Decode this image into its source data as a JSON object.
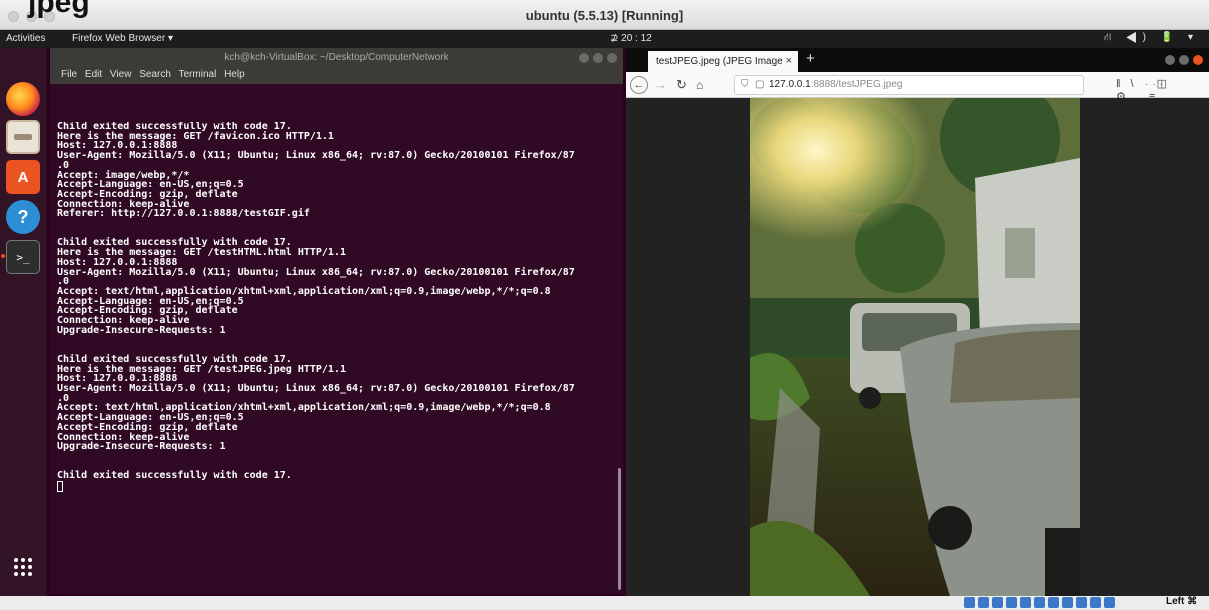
{
  "host_window": {
    "title": "ubuntu (5.5.13) [Running]",
    "cut_heading": "jpeg",
    "host_key": "Left ⌘"
  },
  "topbar": {
    "activities": "Activities",
    "app_menu": "Firefox Web Browser ▾",
    "clock": "⊉ 20 : 12",
    "tray": "⛙ ◀) 🔋 ▾"
  },
  "dock": {
    "items": [
      "firefox-icon",
      "files-icon",
      "software-center-icon",
      "help-icon",
      "terminal-icon"
    ],
    "apps_grid": "show-applications-icon"
  },
  "terminal": {
    "title": "kch@kch-VirtualBox: ~/Desktop/ComputerNetwork",
    "menu": [
      "File",
      "Edit",
      "View",
      "Search",
      "Terminal",
      "Help"
    ],
    "lines": [
      "Child exited successfully with code 17.",
      "Here is the message: GET /favicon.ico HTTP/1.1",
      "Host: 127.0.0.1:8888",
      "User-Agent: Mozilla/5.0 (X11; Ubuntu; Linux x86_64; rv:87.0) Gecko/20100101 Firefox/87",
      ".0",
      "Accept: image/webp,*/*",
      "Accept-Language: en-US,en;q=0.5",
      "Accept-Encoding: gzip, deflate",
      "Connection: keep-alive",
      "Referer: http://127.0.0.1:8888/testGIF.gif",
      "",
      "",
      "Child exited successfully with code 17.",
      "Here is the message: GET /testHTML.html HTTP/1.1",
      "Host: 127.0.0.1:8888",
      "User-Agent: Mozilla/5.0 (X11; Ubuntu; Linux x86_64; rv:87.0) Gecko/20100101 Firefox/87",
      ".0",
      "Accept: text/html,application/xhtml+xml,application/xml;q=0.9,image/webp,*/*;q=0.8",
      "Accept-Language: en-US,en;q=0.5",
      "Accept-Encoding: gzip, deflate",
      "Connection: keep-alive",
      "Upgrade-Insecure-Requests: 1",
      "",
      "",
      "Child exited successfully with code 17.",
      "Here is the message: GET /testJPEG.jpeg HTTP/1.1",
      "Host: 127.0.0.1:8888",
      "User-Agent: Mozilla/5.0 (X11; Ubuntu; Linux x86_64; rv:87.0) Gecko/20100101 Firefox/87",
      ".0",
      "Accept: text/html,application/xhtml+xml,application/xml;q=0.9,image/webp,*/*;q=0.8",
      "Accept-Language: en-US,en;q=0.5",
      "Accept-Encoding: gzip, deflate",
      "Connection: keep-alive",
      "Upgrade-Insecure-Requests: 1",
      "",
      "",
      "Child exited successfully with code 17."
    ]
  },
  "browser": {
    "tab_title": "testJPEG.jpeg (JPEG Image",
    "tab_close": "×",
    "new_tab": "+",
    "url_host": "127.0.0.1",
    "url_rest": ":8888/testJPEG.jpeg",
    "url_more": "··· ♡ ☆",
    "toolbar_right": "‖\\ ◫ ⚙ ≡"
  }
}
